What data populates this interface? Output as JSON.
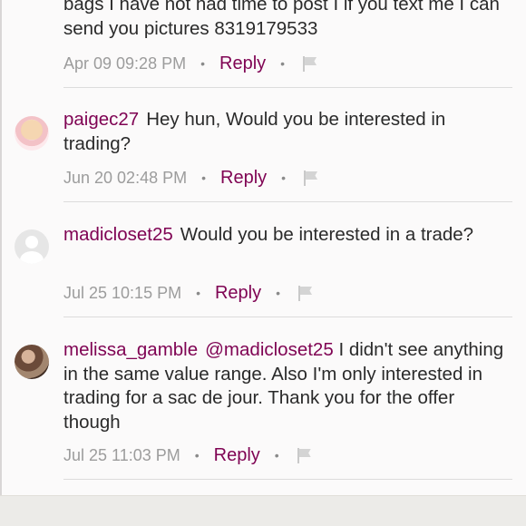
{
  "comments": [
    {
      "username": "",
      "mention": "",
      "text": "bags I have not had time to post I if you text me I can send you pictures 8319179533",
      "timestamp": "Apr 09 09:28 PM",
      "reply_label": "Reply",
      "avatar": ""
    },
    {
      "username": "paigec27",
      "mention": "",
      "text": "Hey hun, Would you be interested in trading?",
      "timestamp": "Jun 20 02:48 PM",
      "reply_label": "Reply",
      "avatar": "profile-photo"
    },
    {
      "username": "madicloset25",
      "mention": "",
      "text": "Would you be interested in a trade?",
      "timestamp": "Jul 25 10:15 PM",
      "reply_label": "Reply",
      "avatar": "default-avatar-icon"
    },
    {
      "username": "melissa_gamble",
      "mention": "@madicloset25",
      "text": "I didn't see anything in the same value range. Also I'm only interested in trading for a sac de jour. Thank you for the offer though",
      "timestamp": "Jul 25 11:03 PM",
      "reply_label": "Reply",
      "avatar": "profile-photo"
    }
  ],
  "icons": {
    "separator": "•",
    "flag": "flag-icon"
  },
  "colors": {
    "accent": "#7f0353",
    "meta": "#9c9c9c",
    "text": "#2a2a2a",
    "background": "#fbfafa"
  }
}
